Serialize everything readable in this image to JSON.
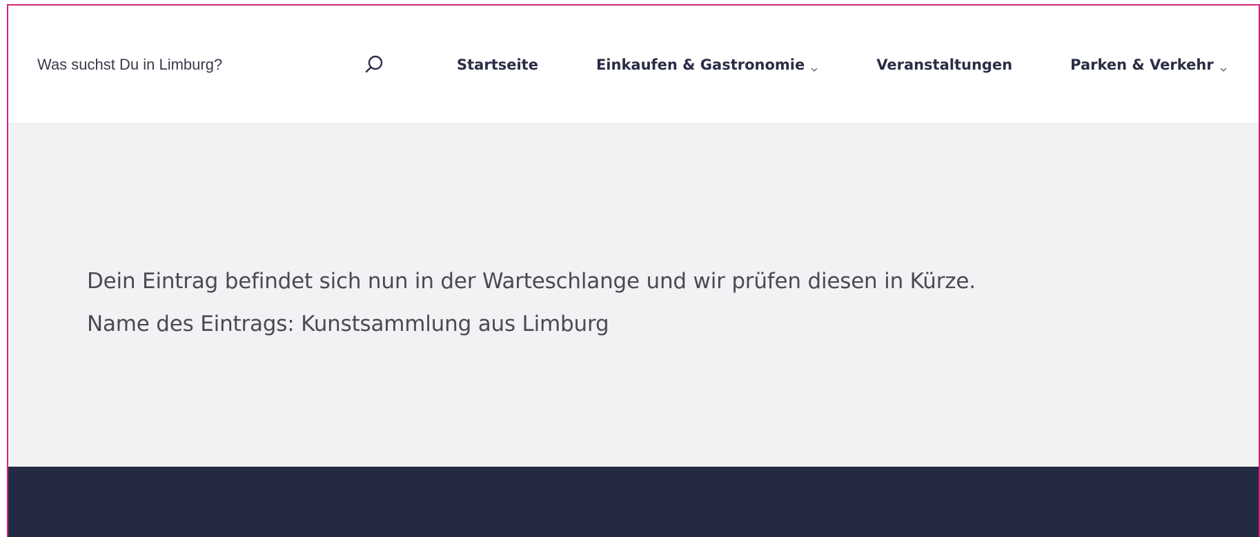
{
  "search": {
    "placeholder": "Was suchst Du in Limburg?",
    "icon": "search-icon"
  },
  "nav": {
    "items": [
      {
        "label": "Startseite",
        "has_dropdown": false
      },
      {
        "label": "Einkaufen & Gastronomie",
        "has_dropdown": true
      },
      {
        "label": "Veranstaltungen",
        "has_dropdown": false
      },
      {
        "label": "Parken & Verkehr",
        "has_dropdown": true
      }
    ]
  },
  "content": {
    "message_line1": "Dein Eintrag befindet sich nun in der Warteschlange und wir prüfen diesen in Kürze.",
    "message_line2": "Name des Eintrags: Kunstsammlung aus Limburg"
  },
  "colors": {
    "accent_border": "#d4237a",
    "content_bg": "#f2f2f4",
    "footer_bg": "#242a41",
    "nav_text": "#2a2d45"
  }
}
